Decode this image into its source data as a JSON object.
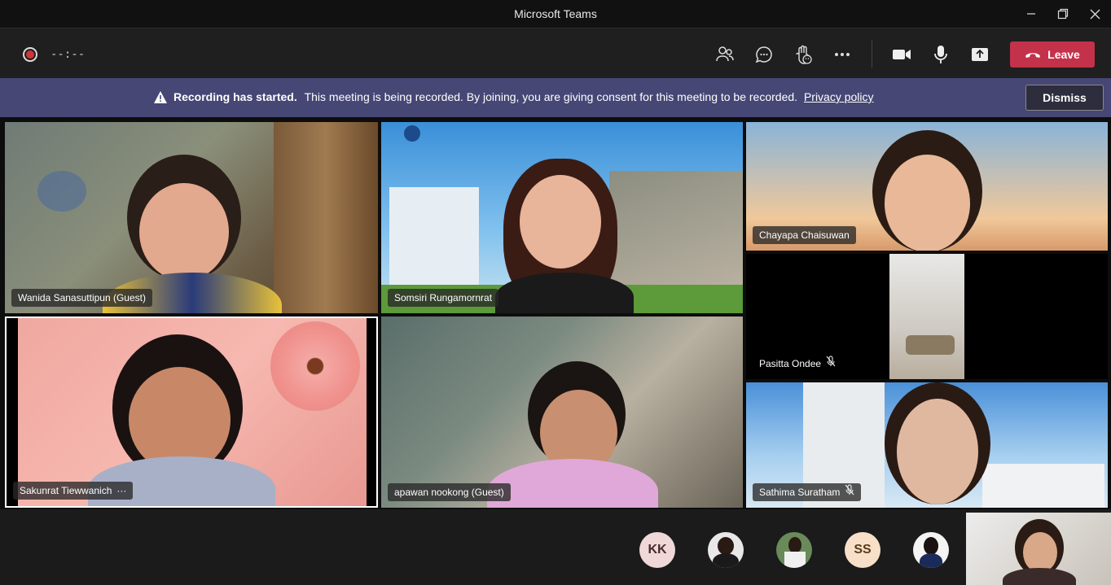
{
  "window": {
    "title": "Microsoft Teams"
  },
  "toolbar": {
    "timer": "--:--",
    "leave_label": "Leave"
  },
  "banner": {
    "title": "Recording has started.",
    "message": "This meeting is being recorded. By joining, you are giving consent for this meeting to be recorded.",
    "link": "Privacy policy",
    "dismiss_label": "Dismiss"
  },
  "participants": [
    {
      "name": "Wanida Sanasuttipun (Guest)"
    },
    {
      "name": "Somsiri Rungamornrat"
    },
    {
      "name": "Chayapa Chaisuwan"
    },
    {
      "name": "Pasitta Ondee"
    },
    {
      "name": "Sakunrat Tiewwanich"
    },
    {
      "name": "apawan nookong (Guest)"
    },
    {
      "name": "Sathima Suratham"
    }
  ],
  "more_dots": "···",
  "avatars": [
    {
      "initials": "KK"
    },
    {
      "initials": ""
    },
    {
      "initials": ""
    },
    {
      "initials": "SS"
    },
    {
      "initials": ""
    }
  ],
  "icons": [
    "record-icon",
    "people-icon",
    "chat-icon",
    "raise-hand-icon",
    "more-icon",
    "camera-icon",
    "microphone-icon",
    "share-screen-icon",
    "hangup-icon",
    "warning-icon",
    "mic-off-icon"
  ],
  "colors": {
    "leave": "#c4314b",
    "banner": "#464775",
    "toolbar": "#1f1f1f"
  }
}
